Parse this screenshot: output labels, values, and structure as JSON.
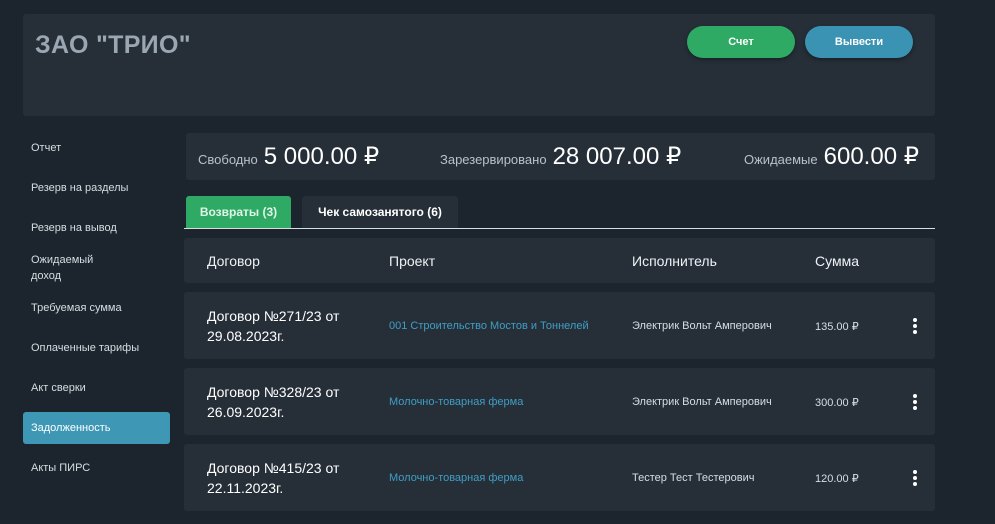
{
  "header": {
    "company": "ЗАО \"ТРИО\"",
    "invoice_button": "Счет",
    "withdraw_button": "Вывести"
  },
  "sidebar": {
    "items": [
      {
        "label": "Отчет"
      },
      {
        "label": "Резерв на разделы"
      },
      {
        "label": "Резерв на вывод"
      },
      {
        "label": "Ожидаемый доход"
      },
      {
        "label": "Требуемая сумма"
      },
      {
        "label": "Оплаченные тарифы"
      },
      {
        "label": "Акт сверки"
      },
      {
        "label": "Задолженность",
        "active": true
      },
      {
        "label": "Акты ПИРС"
      }
    ]
  },
  "balances": {
    "free": {
      "label": "Свободно",
      "value": "5 000.00 ₽"
    },
    "reserved": {
      "label": "Зарезервировано",
      "value": "28 007.00 ₽"
    },
    "expected": {
      "label": "Ожидаемые",
      "value": "600.00 ₽"
    }
  },
  "tabs": [
    {
      "label": "Возвраты (3)",
      "active": true
    },
    {
      "label": "Чек самозанятого (6)",
      "active": false
    }
  ],
  "table": {
    "columns": [
      "Договор",
      "Проект",
      "Исполнитель",
      "Сумма"
    ],
    "rows": [
      {
        "contract": "Договор №271/23 от 29.08.2023г.",
        "project": "001 Строительство Мостов и Тоннелей",
        "executor": "Электрик Вольт Амперович",
        "sum": "135.00 ₽"
      },
      {
        "contract": "Договор №328/23 от 26.09.2023г.",
        "project": "Молочно-товарная ферма",
        "executor": "Электрик Вольт Амперович",
        "sum": "300.00 ₽"
      },
      {
        "contract": "Договор №415/23 от 22.11.2023г.",
        "project": "Молочно-товарная ферма",
        "executor": "Тестер Тест Тестерович",
        "sum": "120.00 ₽"
      }
    ]
  },
  "colors": {
    "background": "#1c252d",
    "panel": "#262f38",
    "accent_green": "#2faa64",
    "accent_blue": "#3a93b3",
    "link": "#3f9ec6"
  }
}
